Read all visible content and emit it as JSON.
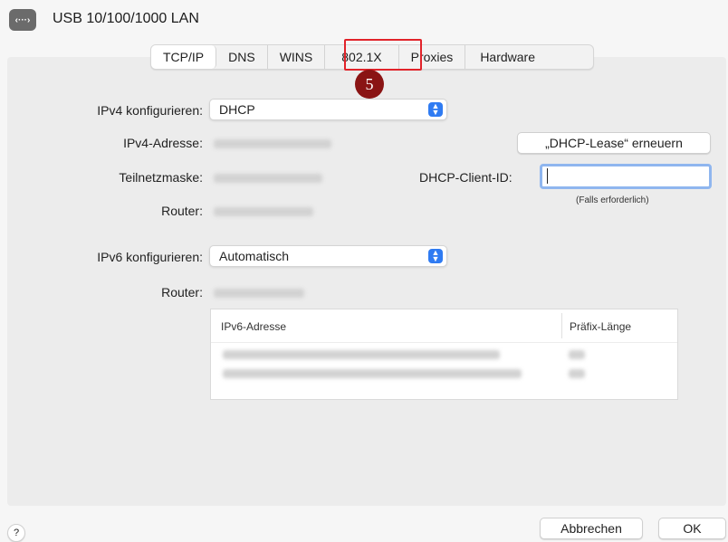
{
  "header": {
    "icon": "network-icon",
    "icon_glyph": "‹···›",
    "title": "USB 10/100/1000 LAN"
  },
  "tabs": [
    {
      "label": "TCP/IP",
      "active": true
    },
    {
      "label": "DNS"
    },
    {
      "label": "WINS"
    },
    {
      "label": "802.1X"
    },
    {
      "label": "Proxies"
    },
    {
      "label": "Hardware"
    }
  ],
  "annotation": {
    "step": "5",
    "color": "#e1232a",
    "badge_color": "#8a1414"
  },
  "ipv4": {
    "configure_label": "IPv4 konfigurieren:",
    "configure_value": "DHCP",
    "address_label": "IPv4-Adresse:",
    "subnet_label": "Teilnetzmaske:",
    "router_label": "Router:",
    "renew_button": "„DHCP-Lease“ erneuern",
    "client_id_label": "DHCP-Client-ID:",
    "client_id_value": "",
    "client_id_hint": "(Falls erforderlich)"
  },
  "ipv6": {
    "configure_label": "IPv6 konfigurieren:",
    "configure_value": "Automatisch",
    "router_label": "Router:",
    "table": {
      "columns": [
        "IPv6-Adresse",
        "Präfix-Länge"
      ]
    }
  },
  "footer": {
    "help": "?",
    "cancel": "Abbrechen",
    "ok": "OK"
  },
  "colors": {
    "accent": "#2f7bf2",
    "focus_ring": "#8fb6ef"
  }
}
